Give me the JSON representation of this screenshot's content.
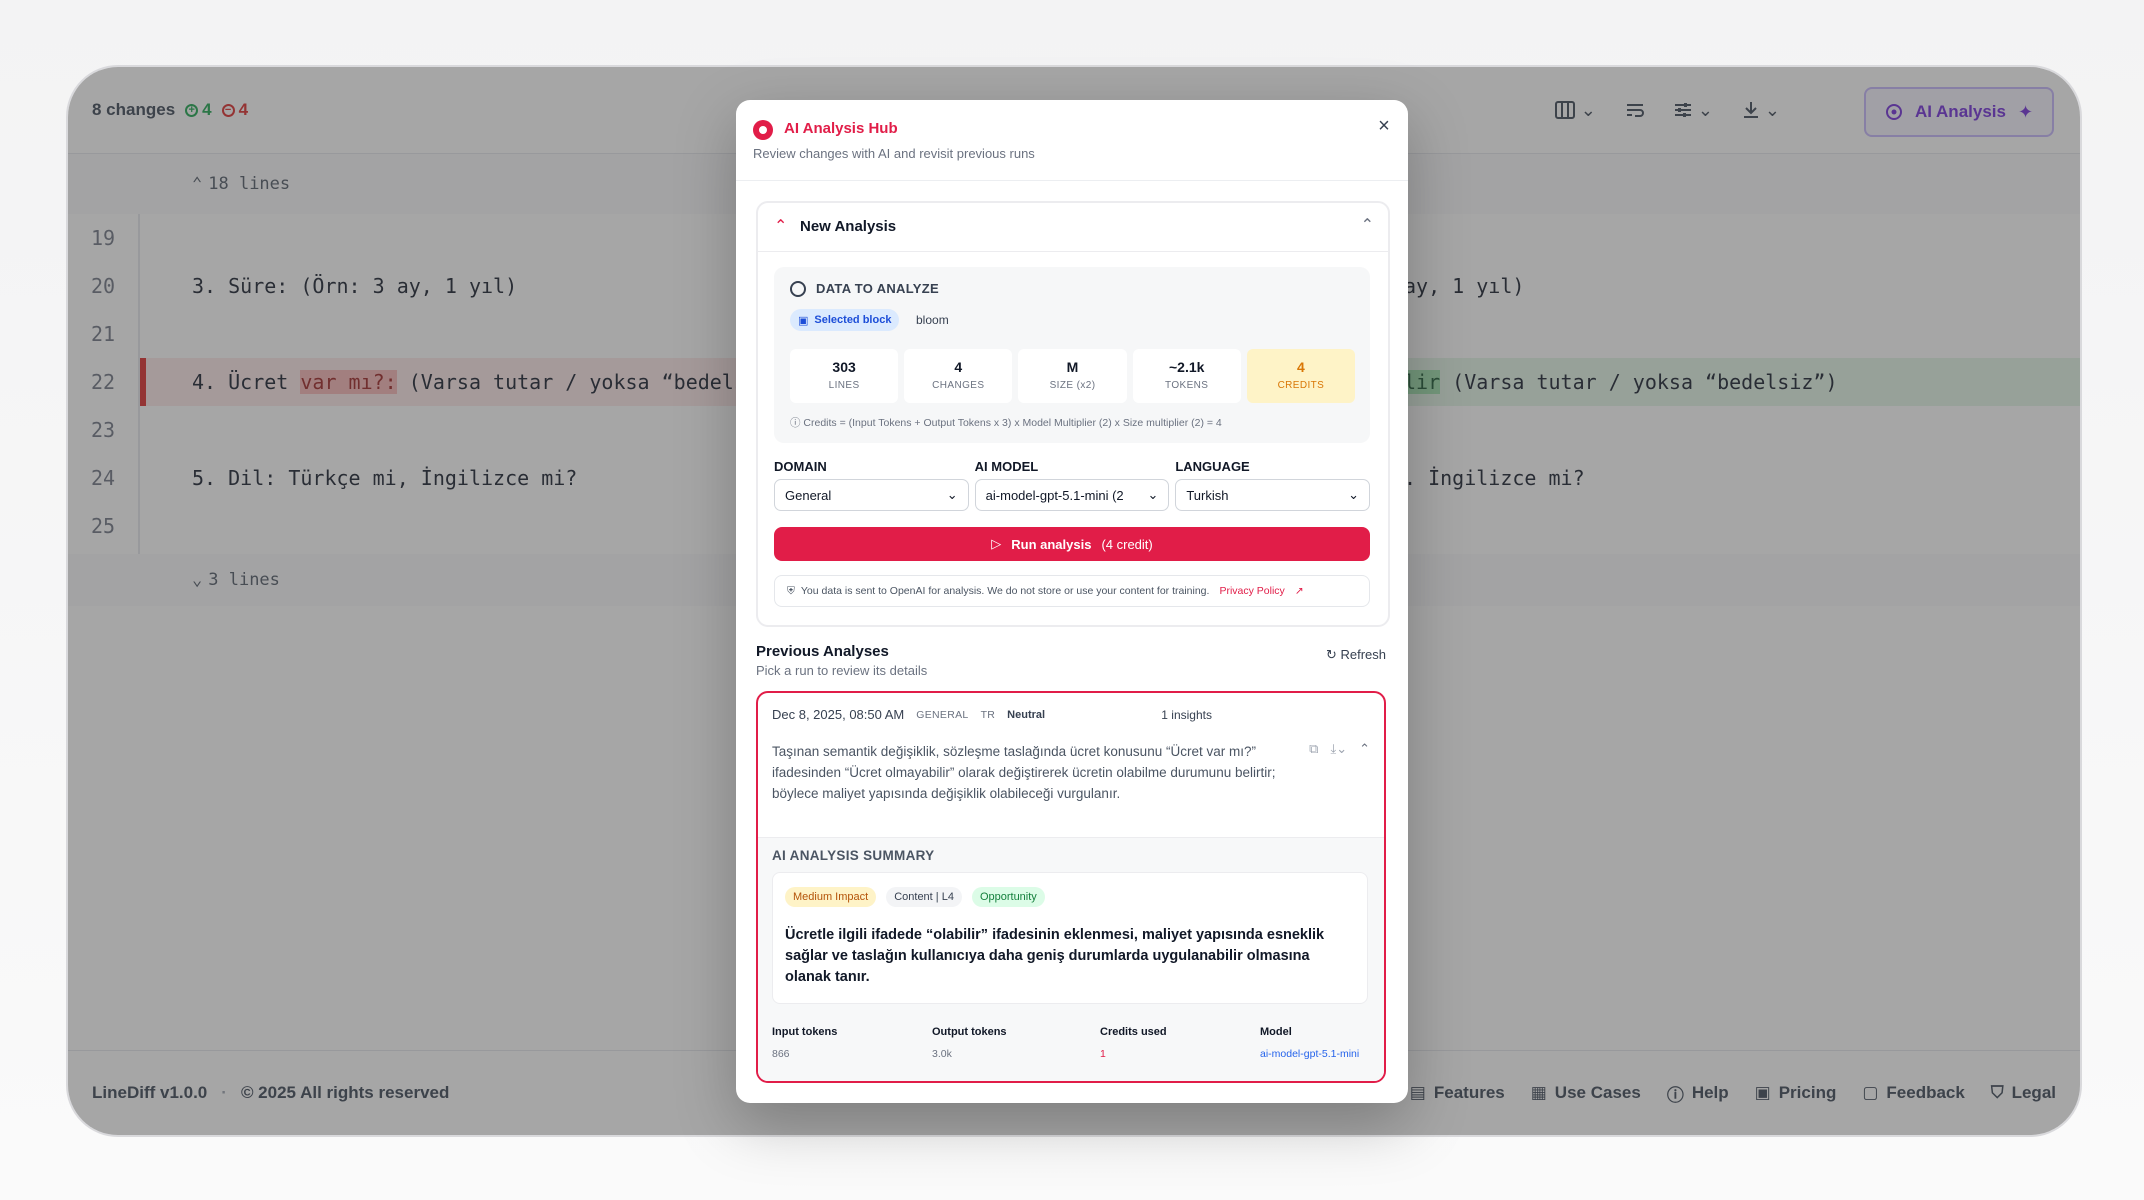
{
  "topbar": {
    "changes_label": "8 changes",
    "additions": "4",
    "removals": "4",
    "ai_button_label": "AI Analysis"
  },
  "diff": {
    "fold_top": "18 lines",
    "fold_bottom": "3 lines",
    "lines": [
      {
        "num": "19",
        "left": "",
        "right": ""
      },
      {
        "num": "20",
        "left": "3. Süre: (Örn: 3 ay, 1 yıl)",
        "right": "ay, 1 yıl)"
      },
      {
        "num": "21",
        "left": "",
        "right": ""
      },
      {
        "num": "22",
        "left_pre": "4. Ücret ",
        "left_del": "var mı?:",
        "left_post": " (Varsa tutar / yoksa “bedels",
        "right_ins": "lir",
        "right_post": " (Varsa tutar / yoksa “bedelsiz”)"
      },
      {
        "num": "23",
        "left": "",
        "right": ""
      },
      {
        "num": "24",
        "left": "5. Dil: Türkçe mi, İngilizce mi?",
        "right": ". İngilizce mi?"
      },
      {
        "num": "25",
        "left": "",
        "right": ""
      }
    ]
  },
  "footer": {
    "version": "LineDiff v1.0.0",
    "sep": "·",
    "copyright": "© 2025 All rights reserved",
    "links": [
      "Features",
      "Use Cases",
      "Help",
      "Pricing",
      "Feedback",
      "Legal"
    ]
  },
  "modal": {
    "title": "AI Analysis Hub",
    "subtitle": "Review changes with AI and revisit previous runs",
    "close": "×",
    "new_analysis": {
      "title": "New Analysis",
      "data_title": "DATA TO ANALYZE",
      "selected_chip": "Selected block",
      "block_name": "bloom",
      "stats": [
        {
          "value": "303",
          "label": "LINES"
        },
        {
          "value": "4",
          "label": "CHANGES"
        },
        {
          "value": "M",
          "label": "SIZE (x2)"
        },
        {
          "value": "~2.1k",
          "label": "TOKENS"
        },
        {
          "value": "4",
          "label": "CREDITS"
        }
      ],
      "formula": "Credits = (Input Tokens + Output Tokens x 3) x Model Multiplier (2) x Size multiplier (2) = 4",
      "domain_label": "DOMAIN",
      "domain_value": "General",
      "model_label": "AI MODEL",
      "model_value": "ai-model-gpt-5.1-mini (2",
      "language_label": "LANGUAGE",
      "language_value": "Turkish",
      "run_label": "Run analysis",
      "run_credit": "(4 credit)",
      "notice": "You data is sent to OpenAI for analysis. We do not store or use your content for training.",
      "privacy": "Privacy Policy"
    },
    "previous": {
      "title": "Previous Analyses",
      "subtitle": "Pick a run to review its details",
      "refresh": "Refresh",
      "run": {
        "date": "Dec 8, 2025, 08:50 AM",
        "domain_tag": "GENERAL",
        "lang_tag": "TR",
        "sentiment": "Neutral",
        "insights": "1 insights",
        "description": "Taşınan semantik değişiklik, sözleşme taslağında ücret konusunu “Ücret var mı?” ifadesinden “Ücret olmayabilir” olarak değiştirerek ücretin olabilme durumunu belirtir; böylece maliyet yapısında değişiklik olabileceği vurgulanır.",
        "summary_title": "AI ANALYSIS SUMMARY",
        "chip_impact": "Medium Impact",
        "chip_content": "Content | L4",
        "chip_opp": "Opportunity",
        "summary_text": "Ücretle ilgili ifadede “olabilir” ifadesinin eklenmesi, maliyet yapısında esneklik sağlar ve taslağın kullanıcıya daha geniş durumlarda uygulanabilir olmasına olanak tanır.",
        "tokens": [
          {
            "label": "Input tokens",
            "value": "866"
          },
          {
            "label": "Output tokens",
            "value": "3.0k"
          },
          {
            "label": "Credits used",
            "value": "1"
          },
          {
            "label": "Model",
            "value": "ai-model-gpt-5.1-mini"
          }
        ]
      }
    }
  },
  "colors": {
    "accent": "#e11d48",
    "add": "#16a34a",
    "remove": "#dc2626",
    "ai": "#6d28d9"
  }
}
